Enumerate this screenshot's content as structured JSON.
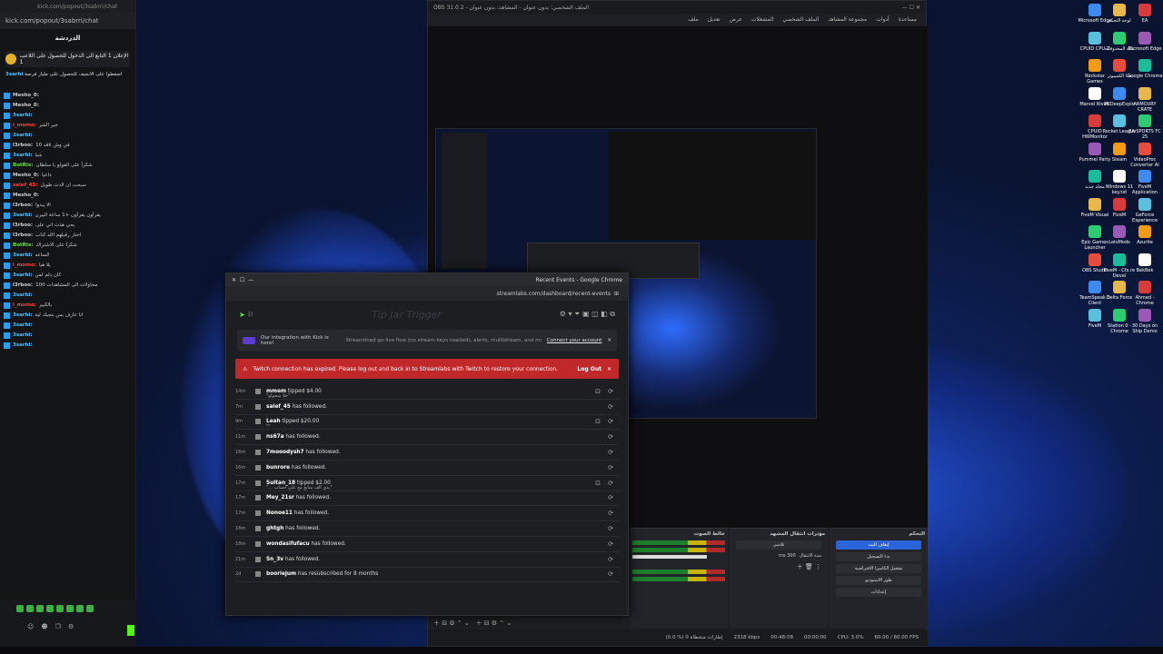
{
  "chat": {
    "chrome_title": "kick.com/popout/3sabrri/chat",
    "url": "kick.com/popout/3sabrri/chat",
    "title": "الدردشة",
    "pinned": "الإعلان 1 التابع الى الدخول للحصول على اللاعب 1",
    "pinned_user": "3sarhi",
    "pinned_msg": "اضغطوا على الانجيف للحصول على مليار فرصة",
    "messages": [
      {
        "user": "Mesho_0:",
        "text": "",
        "color": "#cfcfcf"
      },
      {
        "user": "Mesho_0:",
        "text": "",
        "color": "#cfcfcf"
      },
      {
        "user": "3sarhi:",
        "text": "",
        "color": "#4fbfff"
      },
      {
        "user": "i_momo:",
        "text": "خير الشر",
        "color": "#ff4040"
      },
      {
        "user": "3sarhi:",
        "text": "",
        "color": "#4fbfff"
      },
      {
        "user": "l3rboo:",
        "text": "قد 10k في وش",
        "color": "#cfcfcf"
      },
      {
        "user": "3sarhi:",
        "text": "شيا",
        "color": "#4fbfff"
      },
      {
        "user": "BotRix:",
        "text": "شكراً على الفولو يا سلطان",
        "color": "#53fc18"
      },
      {
        "user": "Mesho_0:",
        "text": "داعيا",
        "color": "#cfcfcf"
      },
      {
        "user": "salef_45:",
        "text": "سبحت ان الدت طويل",
        "color": "#ff4040"
      },
      {
        "user": "Mesho_0:",
        "text": "",
        "color": "#cfcfcf"
      },
      {
        "user": "l3rboo:",
        "text": "الا يبدوا",
        "color": "#cfcfcf"
      },
      {
        "user": "3sarhi:",
        "text": "يقرأون يقرأون +1 ساعة البيرن",
        "color": "#4fbfff"
      },
      {
        "user": "l3rboo:",
        "text": "يحي هذت اتي على",
        "color": "#cfcfcf"
      },
      {
        "user": "l3rboo:",
        "text": "اختار رقيلهم الله كتاب",
        "color": "#cfcfcf"
      },
      {
        "user": "BotRix:",
        "text": "شكراً على الاشتراك",
        "color": "#53fc18"
      },
      {
        "user": "3sarhi:",
        "text": "الساعه",
        "color": "#4fbfff"
      },
      {
        "user": "i_momo:",
        "text": "يلا هيا",
        "color": "#ff4040"
      },
      {
        "user": "3sarhi:",
        "text": "كان دلم لمن",
        "color": "#4fbfff"
      },
      {
        "user": "l3rboo:",
        "text": "محاولات الى المشاهدات 100",
        "color": "#cfcfcf"
      },
      {
        "user": "3sarhi:",
        "text": "",
        "color": "#4fbfff"
      },
      {
        "user": "i_momo:",
        "text": "بالكبير",
        "color": "#ff4040"
      },
      {
        "user": "3sarhi:",
        "text": "انا عارف بس بتجيك لية",
        "color": "#4fbfff"
      },
      {
        "user": "3sarhi:",
        "text": "",
        "color": "#4fbfff"
      },
      {
        "user": "3sarhi:",
        "text": "",
        "color": "#4fbfff"
      },
      {
        "user": "3sarhi:",
        "text": "",
        "color": "#4fbfff"
      }
    ]
  },
  "obs": {
    "title": "OBS 31.0.2 - الملف الشخصي: بدون عنوان - المشاهد: بدون عنوان",
    "menu": [
      "ملف",
      "تعديل",
      "عرض",
      "المشغلات",
      "الملف الشخصي",
      "مجموعة المشاهد",
      "أدوات",
      "مساعدة"
    ],
    "dock_audio": "خالط الصوت",
    "dock_transitions": "مؤثرات انتقال المشهد",
    "dock_controls": "التحكم",
    "transition_value": "تلاشي",
    "duration": "300 ms",
    "duration_label": "مدة الانتقال",
    "ctrl_buttons": [
      "إيقاف البث",
      "بدء التسجيل",
      "تشغيل الكاميرا الافتراضية",
      "طور الاستوديو",
      "إعدادات"
    ],
    "status": [
      "(0.0 %) 0 إطارات متخطاة",
      "2318 kbps",
      "00:48:08",
      "00:00:00",
      "CPU: 3.0%",
      "60.00 / 60.00 FPS"
    ]
  },
  "recent": {
    "title": "Recent Events - Google Chrome",
    "url": "streamlabs.com/dashboard/recent-events",
    "ghost": "Tip Jar Trigger",
    "kick_text": "Our integration with Kick is here!",
    "kick_desc": "Streamlined go-live flow (no stream keys needed), alerts, multistream, and more.",
    "kick_link": "Connect your account",
    "error_text": "Twitch connection has expired. Please log out and back in to Streamlabs with Twitch to restore your connection.",
    "logout": "Log Out",
    "events": [
      {
        "ago": "14m",
        "name": "mmem",
        "rest": " tipped $4.00",
        "sub": "\"خلا متحولو\""
      },
      {
        "ago": "7m",
        "name": "salef_45",
        "rest": " has followed.",
        "sub": ""
      },
      {
        "ago": "9m",
        "name": "Leah",
        "rest": " tipped $20.00",
        "sub": "\"\""
      },
      {
        "ago": "11m",
        "name": "ns67a",
        "rest": " has followed.",
        "sub": ""
      },
      {
        "ago": "16m",
        "name": "7mooodysh7",
        "rest": " has followed.",
        "sub": ""
      },
      {
        "ago": "16m",
        "name": "bunrore",
        "rest": " has followed.",
        "sub": ""
      },
      {
        "ago": "17m",
        "name": "Sultan_18",
        "rest": " tipped $2.00",
        "sub": "\"بدي الف متابع مع علي حساب ...\""
      },
      {
        "ago": "17m",
        "name": "Mey_21sr",
        "rest": " has followed.",
        "sub": ""
      },
      {
        "ago": "17m",
        "name": "Nonoe11",
        "rest": " has followed.",
        "sub": ""
      },
      {
        "ago": "18m",
        "name": "ghtgh",
        "rest": " has followed.",
        "sub": ""
      },
      {
        "ago": "18m",
        "name": "wondasifufacu",
        "rest": " has followed.",
        "sub": ""
      },
      {
        "ago": "21m",
        "name": "Sn_3v",
        "rest": " has followed.",
        "sub": ""
      },
      {
        "ago": "2d",
        "name": "boorlejum",
        "rest": " has resubscribed for 8 months",
        "sub": ""
      }
    ]
  },
  "icons": [
    {
      "label": "Microsoft Edge"
    },
    {
      "label": "لوحة التحكم"
    },
    {
      "label": "EA"
    },
    {
      "label": "CPUID CPU-Z"
    },
    {
      "label": "سلة المحذوفات"
    },
    {
      "label": "Microsoft Edge"
    },
    {
      "label": "Rockstar Games"
    },
    {
      "label": "هذا الكمبيوتر"
    },
    {
      "label": "Google Chrome"
    },
    {
      "label": "Marvel Rivals"
    },
    {
      "label": "PCDeepExplo"
    },
    {
      "label": "ARMOURY CRATE"
    },
    {
      "label": "CPUID HWMonitor"
    },
    {
      "label": "Rocket League"
    },
    {
      "label": "EA SPORTS FC 25"
    },
    {
      "label": "Pummel Party"
    },
    {
      "label": "Steam"
    },
    {
      "label": "VideoProc Converter AI"
    },
    {
      "label": "مجلد جديد"
    },
    {
      "label": "Windows 11 key.txt"
    },
    {
      "label": "FiveM Application"
    },
    {
      "label": "FiveM Visual"
    },
    {
      "label": "FiveM"
    },
    {
      "label": "GeForce Experience"
    },
    {
      "label": "Epic Games Launcher"
    },
    {
      "label": "LetsMods"
    },
    {
      "label": "Azurite"
    },
    {
      "label": "OBS Studio"
    },
    {
      "label": "FiveM - Cfx.re Devel"
    },
    {
      "label": "BekBek"
    },
    {
      "label": "TeamSpeak 3 Client"
    },
    {
      "label": "Delta Force"
    },
    {
      "label": "Ahmed - Chrome"
    },
    {
      "label": "FiveM"
    },
    {
      "label": "Station 0 - Chrome"
    },
    {
      "label": "30 Days on Ship Demo"
    }
  ]
}
